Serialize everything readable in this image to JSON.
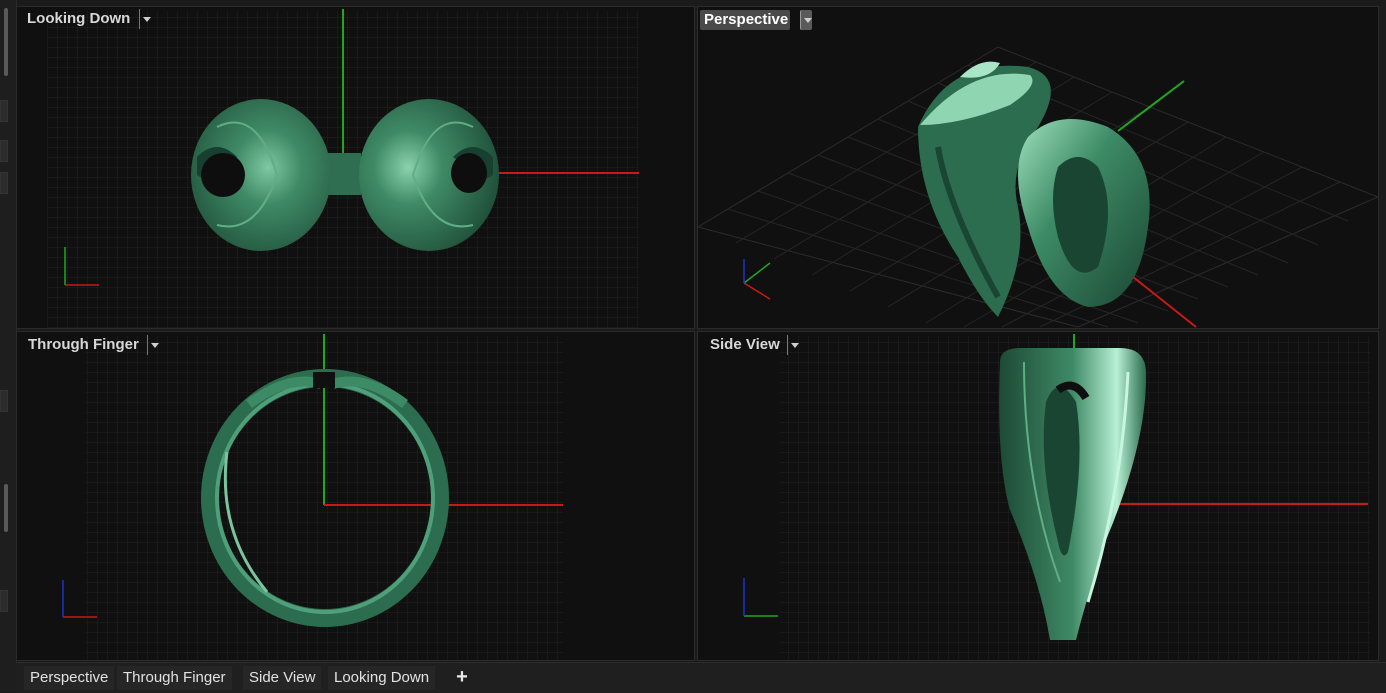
{
  "viewports": [
    {
      "title": "Looking Down"
    },
    {
      "title": "Perspective",
      "active": true
    },
    {
      "title": "Through Finger"
    },
    {
      "title": "Side View"
    }
  ],
  "tabs": [
    "Perspective",
    "Through Finger",
    "Side View",
    "Looking Down"
  ],
  "add_tab_label": "+",
  "icons": {
    "viewport_menu": "chevron-down-icon",
    "add_tab": "plus-icon"
  },
  "colors": {
    "model": "#2e7a58",
    "x_axis": "#d01818",
    "y_axis": "#18b818",
    "z_axis": "#2030d0",
    "grid": "#2a2a2a",
    "background": "#101010"
  }
}
